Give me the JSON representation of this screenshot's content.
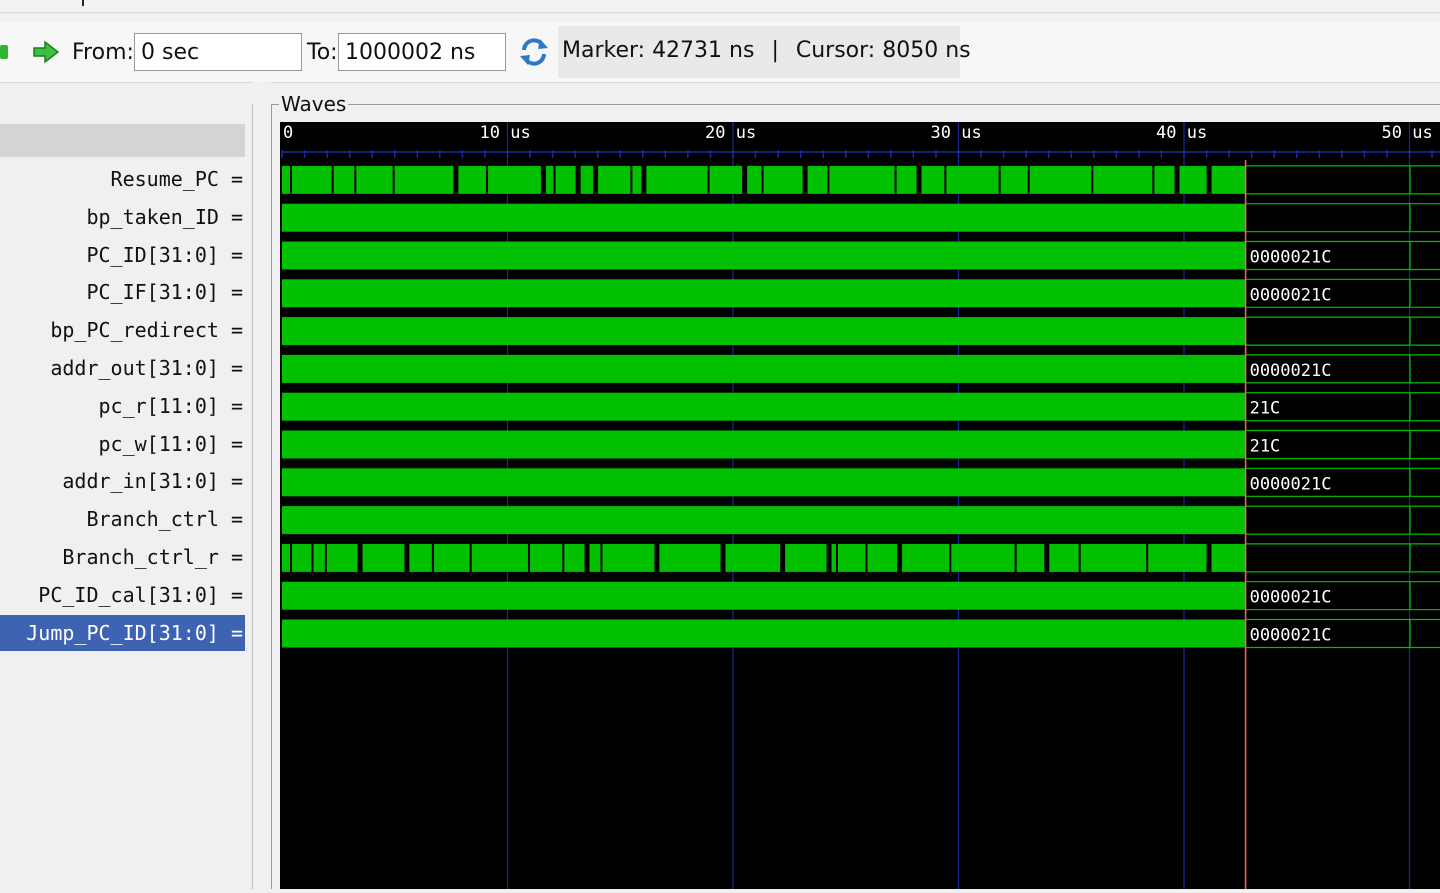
{
  "toolbar": {
    "from_label": "From:",
    "from_value": "0 sec",
    "to_label": "To:",
    "to_value": "1000002 ns",
    "marker_text": "Marker: 42731 ns",
    "separator": "|",
    "cursor_text": "Cursor: 8050 ns",
    "icons": [
      "green-square-icon",
      "green-arrow-right-icon",
      "refresh-icon"
    ]
  },
  "waves": {
    "title": "Waves",
    "time_ticks": [
      {
        "value_us": 0,
        "label": "0"
      },
      {
        "value_us": 10,
        "label": "10 us"
      },
      {
        "value_us": 20,
        "label": "20 us"
      },
      {
        "value_us": 30,
        "label": "30 us"
      },
      {
        "value_us": 40,
        "label": "40 us"
      },
      {
        "value_us": 50,
        "label": "50 us"
      }
    ],
    "marker_us": 42.731,
    "trace_end_us": 42.731,
    "signals": [
      {
        "name": "Resume_PC =",
        "kind": "bit",
        "value": ""
      },
      {
        "name": "bp_taken_ID =",
        "kind": "bus",
        "value": ""
      },
      {
        "name": "PC_ID[31:0] =",
        "kind": "bus",
        "value": "0000021C"
      },
      {
        "name": "PC_IF[31:0] =",
        "kind": "bus",
        "value": "0000021C"
      },
      {
        "name": "bp_PC_redirect =",
        "kind": "bus",
        "value": ""
      },
      {
        "name": "addr_out[31:0] =",
        "kind": "bus",
        "value": "0000021C"
      },
      {
        "name": "pc_r[11:0] =",
        "kind": "bus",
        "value": "21C"
      },
      {
        "name": "pc_w[11:0] =",
        "kind": "bus",
        "value": "21C"
      },
      {
        "name": "addr_in[31:0] =",
        "kind": "bus",
        "value": "0000021C"
      },
      {
        "name": "Branch_ctrl =",
        "kind": "bus",
        "value": ""
      },
      {
        "name": "Branch_ctrl_r =",
        "kind": "bit",
        "value": ""
      },
      {
        "name": "PC_ID_cal[31:0] =",
        "kind": "bus",
        "value": "0000021C"
      },
      {
        "name": "Jump_PC_ID[31:0] =",
        "kind": "bus",
        "value": "0000021C",
        "selected": true
      }
    ]
  },
  "colors": {
    "wave": "#00c000",
    "marker": "#ff6060",
    "grid": "#1a2a9a",
    "selection": "#3f63b3"
  }
}
